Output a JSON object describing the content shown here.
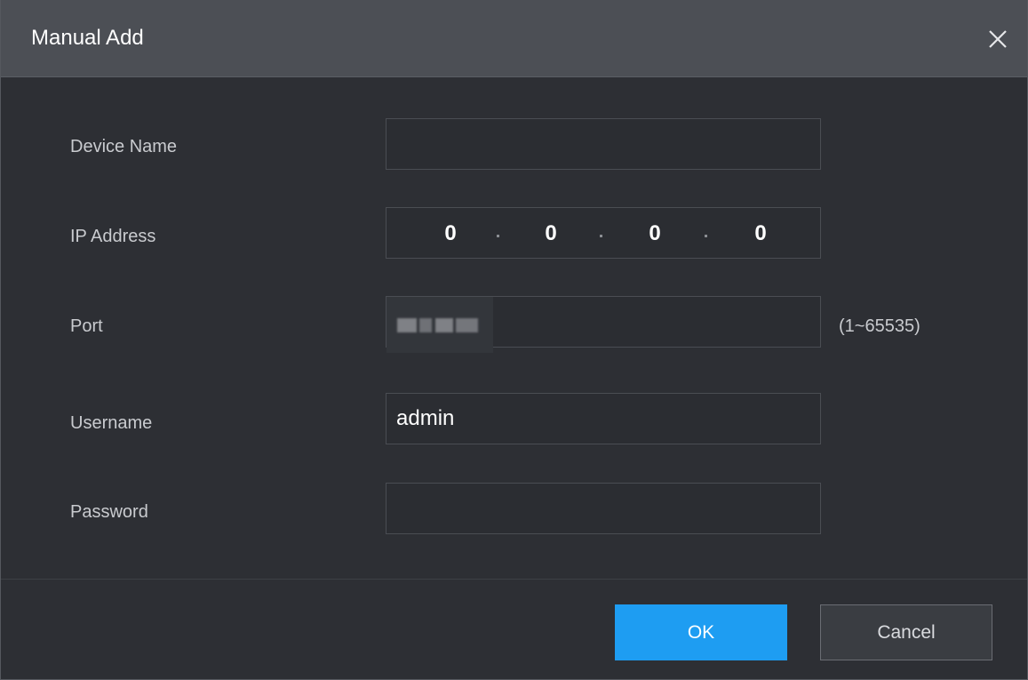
{
  "dialog": {
    "title": "Manual Add",
    "close_icon": "close-icon"
  },
  "form": {
    "device_name": {
      "label": "Device Name",
      "value": ""
    },
    "ip_address": {
      "label": "IP Address",
      "octets": [
        "0",
        "0",
        "0",
        "0"
      ]
    },
    "port": {
      "label": "Port",
      "value": "",
      "hint": "(1~65535)"
    },
    "username": {
      "label": "Username",
      "value": "admin"
    },
    "password": {
      "label": "Password",
      "value": ""
    }
  },
  "buttons": {
    "ok_label": "OK",
    "cancel_label": "Cancel"
  },
  "colors": {
    "accent": "#1e9df2",
    "title_bar": "#4c4f55",
    "background": "#2d2f34"
  }
}
